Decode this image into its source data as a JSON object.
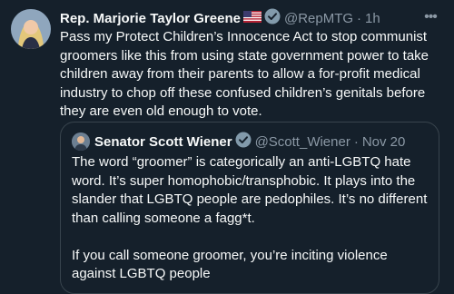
{
  "tweet": {
    "display_name": "Rep. Marjorie Taylor Greene",
    "handle": "@RepMTG",
    "separator": "·",
    "time": "1h",
    "text": "Pass my Protect Children’s Innocence Act to stop communist groomers like this from using state government power to take children away from their parents to allow a for-profit medical industry to chop off these confused children’s genitals before they are even old enough to vote.",
    "more_icon": "more-icon"
  },
  "quoted_tweet": {
    "display_name": "Senator Scott Wiener",
    "handle": "@Scott_Wiener",
    "separator": "·",
    "time": "Nov 20",
    "text": "The word “groomer” is categorically an anti-LGBTQ hate word. It’s super homophobic/transphobic. It plays into the slander that LGBTQ people are pedophiles. It’s no different than calling someone a fagg*t.\n\nIf you call someone groomer, you’re inciting violence against LGBTQ people"
  },
  "colors": {
    "background": "#15202b",
    "text": "#f7f9f9",
    "muted": "#8b98a5",
    "border": "#38444d",
    "badge_gray": "#829aab"
  }
}
